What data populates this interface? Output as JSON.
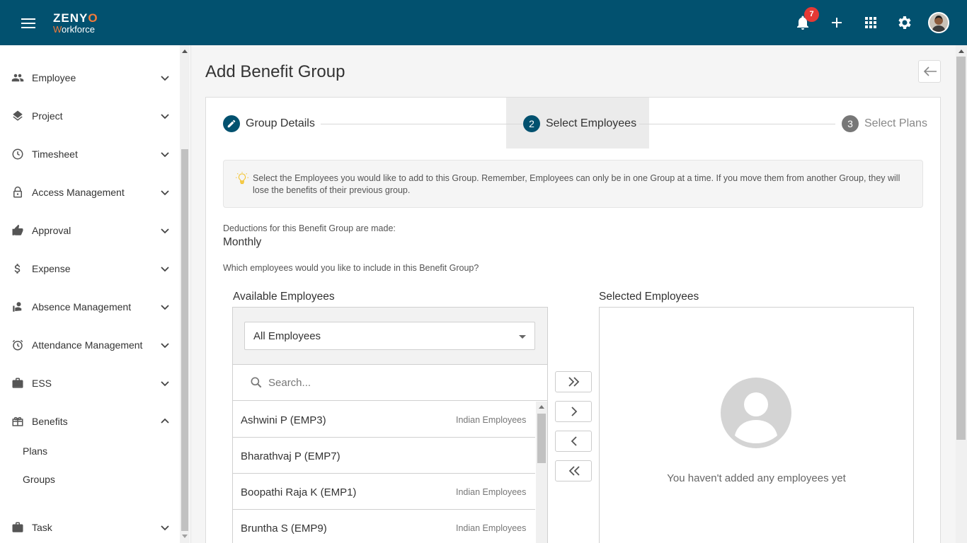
{
  "app": {
    "brand_line1_a": "ZENY",
    "brand_line1_b": "O",
    "brand_line2_a": "W",
    "brand_line2_b": "orkforce",
    "notification_count": "7",
    "topbar_color": "#02516f"
  },
  "sidebar": {
    "items": [
      {
        "label": "Employee",
        "icon": "people-icon"
      },
      {
        "label": "Project",
        "icon": "layers-icon"
      },
      {
        "label": "Timesheet",
        "icon": "clock-icon"
      },
      {
        "label": "Access Management",
        "icon": "lock-icon"
      },
      {
        "label": "Approval",
        "icon": "thumb-up-icon"
      },
      {
        "label": "Expense",
        "icon": "dollar-icon"
      },
      {
        "label": "Absence Management",
        "icon": "absence-icon"
      },
      {
        "label": "Attendance Management",
        "icon": "alarm-icon"
      },
      {
        "label": "ESS",
        "icon": "briefcase-icon"
      },
      {
        "label": "Benefits",
        "icon": "gift-icon"
      },
      {
        "label": "Task",
        "icon": "briefcase-icon"
      }
    ],
    "benefits_sub": [
      "Plans",
      "Groups"
    ]
  },
  "page": {
    "title": "Add Benefit Group"
  },
  "steps": [
    {
      "number": "1",
      "label": "Group Details",
      "state": "done"
    },
    {
      "number": "2",
      "label": "Select Employees",
      "state": "active"
    },
    {
      "number": "3",
      "label": "Select Plans",
      "state": "pending"
    }
  ],
  "info": {
    "text": "Select the Employees you would like to add to this Group. Remember, Employees can only be in one Group at a time. If you move them from another Group, they will lose the benefits of their previous group."
  },
  "deductions": {
    "label": "Deductions for this Benefit Group are made:",
    "value": "Monthly"
  },
  "question": "Which employees would you like to include in this Benefit Group?",
  "available": {
    "title": "Available Employees",
    "filter_value": "All Employees",
    "search_placeholder": "Search...",
    "employees": [
      {
        "name": "Ashwini P (EMP3)",
        "group": "Indian Employees"
      },
      {
        "name": "Bharathvaj P (EMP7)",
        "group": ""
      },
      {
        "name": "Boopathi Raja K (EMP1)",
        "group": "Indian Employees"
      },
      {
        "name": "Bruntha S (EMP9)",
        "group": "Indian Employees"
      }
    ]
  },
  "selected": {
    "title": "Selected Employees",
    "empty_text": "You haven't added any employees yet"
  }
}
